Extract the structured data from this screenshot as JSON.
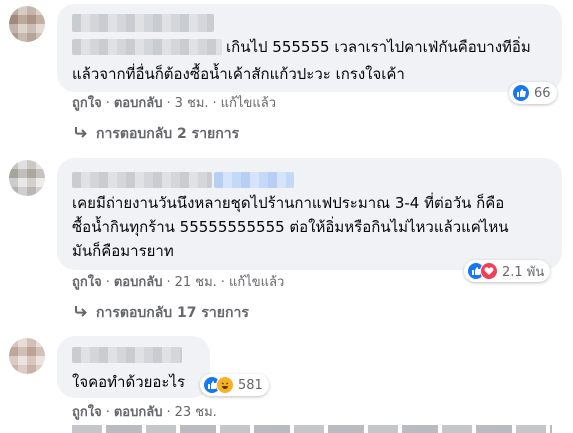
{
  "comments": [
    {
      "text_lines": [
        "เกินไป 555555 เวลาเราไปคาเฟ่กันคือบางทีอิ่ม",
        "แล้วจากที่อื่นก็ต้องซื้อน้ำเค้าสักแก้วปะวะ เกรงใจเค้า"
      ],
      "actions": {
        "like": "ถูกใจ",
        "reply": "ตอบกลับ",
        "time": "3 ชม.",
        "edited": "แก้ไขแล้ว"
      },
      "reactions": {
        "count": "66",
        "icons": [
          "like-icon"
        ]
      },
      "replies_label": "การตอบกลับ 2 รายการ"
    },
    {
      "text_lines": [
        "เคยมีถ่ายงานวันนึงหลายชุดไปร้านกาแฟประมาณ 3-4 ที่ต่อวัน ก็คือ",
        "ซื้อน้ำกินทุกร้าน 55555555555 ต่อให้อิ่มหรือกินไม่ไหวแล้วแค่ไหน",
        "มันก็คือมารยาท"
      ],
      "actions": {
        "like": "ถูกใจ",
        "reply": "ตอบกลับ",
        "time": "21 ชม.",
        "edited": "แก้ไขแล้ว"
      },
      "reactions": {
        "count": "2.1 พัน",
        "icons": [
          "like-icon",
          "love-icon"
        ]
      },
      "replies_label": "การตอบกลับ 17 รายการ"
    },
    {
      "text_lines": [
        "ใจคอทำด้วยอะไร"
      ],
      "actions": {
        "like": "ถูกใจ",
        "reply": "ตอบกลับ",
        "time": "23 ชม."
      },
      "reactions": {
        "count": "581",
        "icons": [
          "like-icon",
          "haha-icon"
        ]
      }
    }
  ],
  "colors": {
    "bubble": "#f0f2f5",
    "secondary_text": "#65676b",
    "like": "#1877f2",
    "love": "#f33e58",
    "haha": "#f7b125"
  }
}
